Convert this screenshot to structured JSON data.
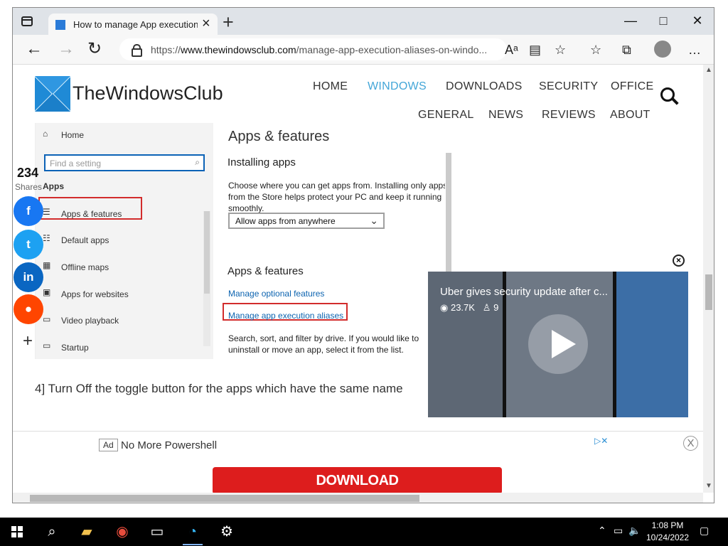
{
  "browser": {
    "tab_title": "How to manage App execution a",
    "new_tab": "+",
    "window_controls": {
      "minimize": "—",
      "maximize": "□",
      "close": "✕"
    },
    "url_prefix": "https://",
    "url_host": "www.thewindowsclub.com",
    "url_rest": "/manage-app-execution-aliases-on-windo...",
    "toolbar_icons": [
      "read-aloud-icon",
      "immersive-reader-icon",
      "favorite-add-icon",
      "favorites-icon",
      "collections-icon",
      "profile-icon",
      "more-icon"
    ]
  },
  "site": {
    "logo_text": "TheWindowsClub",
    "nav_top": [
      "HOME",
      "WINDOWS",
      "DOWNLOADS",
      "SECURITY",
      "OFFICE"
    ],
    "nav_bottom": [
      "GENERAL",
      "NEWS",
      "REVIEWS",
      "ABOUT"
    ],
    "active_nav": "WINDOWS",
    "accent": "#43a6d8"
  },
  "settings_screenshot": {
    "home": "Home",
    "search_placeholder": "Find a setting",
    "section": "Apps",
    "items": [
      "Apps & features",
      "Default apps",
      "Offline maps",
      "Apps for websites",
      "Video playback",
      "Startup"
    ],
    "title": "Apps & features",
    "installing_heading": "Installing apps",
    "installing_text": "Choose where you can get apps from. Installing only apps from the Store helps protect your PC and keep it running smoothly.",
    "select_value": "Allow apps from anywhere",
    "features_heading": "Apps & features",
    "link_optional": "Manage optional features",
    "link_aliases": "Manage app execution aliases",
    "filter_text": "Search, sort, and filter by drive. If you would like to uninstall or move an app, select it from the list."
  },
  "social": {
    "count": "234",
    "label": "Shares",
    "buttons": [
      "facebook-icon",
      "twitter-icon",
      "linkedin-icon",
      "reddit-icon"
    ],
    "plus": "+"
  },
  "article": {
    "step": "4] Turn Off the toggle button for the apps which have the same name"
  },
  "video": {
    "title": "Uber gives security update after c...",
    "views": "23.7K",
    "likes": "9"
  },
  "ad": {
    "label": "Ad",
    "title": "No More Powershell",
    "button": "DOWNLOAD",
    "close": "X"
  },
  "taskbar": {
    "time": "1:08 PM",
    "date": "10/24/2022"
  }
}
